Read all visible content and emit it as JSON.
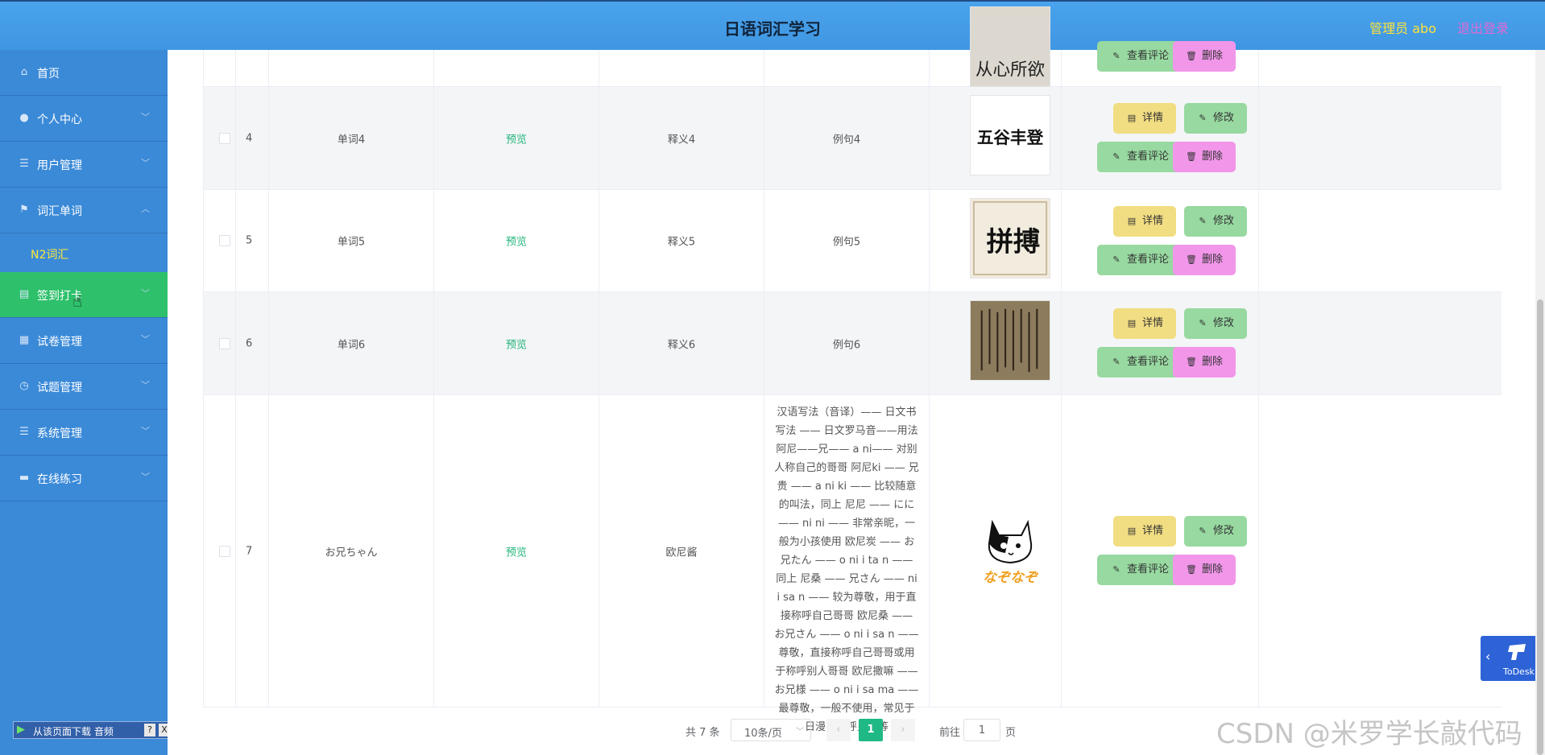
{
  "header": {
    "title": "日语词汇学习",
    "admin": "管理员 abo",
    "logout": "退出登录"
  },
  "sidebar": {
    "items": [
      {
        "label": "首页",
        "icon": "home-icon"
      },
      {
        "label": "个人中心",
        "icon": "user-icon"
      },
      {
        "label": "用户管理",
        "icon": "list-icon"
      },
      {
        "label": "词汇单词",
        "icon": "flag-icon"
      },
      {
        "label": "N2词汇",
        "sub": true
      },
      {
        "label": "签到打卡",
        "icon": "calendar-icon"
      },
      {
        "label": "试卷管理",
        "icon": "grid-icon"
      },
      {
        "label": "试题管理",
        "icon": "clock-icon"
      },
      {
        "label": "系统管理",
        "icon": "list-icon"
      },
      {
        "label": "在线练习",
        "icon": "monitor-icon"
      }
    ]
  },
  "table": {
    "rows": [
      {
        "idx": "4",
        "word": "单词4",
        "preview": "预览",
        "meaning": "释义4",
        "example": "例句4"
      },
      {
        "idx": "5",
        "word": "单词5",
        "preview": "预览",
        "meaning": "释义5",
        "example": "例句5"
      },
      {
        "idx": "6",
        "word": "单词6",
        "preview": "预览",
        "meaning": "释义6",
        "example": "例句6"
      },
      {
        "idx": "7",
        "word": "お兄ちゃん",
        "preview": "预览",
        "meaning": "欧尼酱",
        "example": "汉语写法（音译）—— 日文书写法 —— 日文罗马音——用法 阿尼——兄—— a ni—— 对别人称自己的哥哥 阿尼ki —— 兄贵 —— a ni ki —— 比较随意的叫法，同上 尼尼 —— にに —— ni ni —— 非常亲昵，一般为小孩使用 欧尼炭 —— お兄たん —— o ni i ta n —— 同上 尼桑 —— 兄さん —— ni i sa n —— 较为尊敬，用于直接称呼自己哥哥 欧尼桑 —— お兄さん —— o ni i sa n —— 尊敬，直接称呼自己哥哥或用于称呼别人哥哥 欧尼撒嘛 —— お兄様 —— o ni i sa ma —— 最尊敬，一般不使用，常见于日漫中称呼皇兄等"
      }
    ],
    "actions": {
      "detail": "详情",
      "edit": "修改",
      "comment": "查看评论",
      "delete": "删除"
    },
    "image_text": {
      "row4": "五谷丰登",
      "row5": "拼搏",
      "row7": "なぞなぞ",
      "top_partial": "从心所欲"
    }
  },
  "pagination": {
    "total": "共 7 条",
    "page_size": "10条/页",
    "current": "1",
    "goto_prefix": "前往",
    "goto_value": "1",
    "goto_suffix": "页"
  },
  "audio_toolbar": {
    "label": "从该页面下载 音频",
    "help": "?",
    "close": "X"
  },
  "todesk": {
    "label": "ToDesk"
  },
  "watermark": "CSDN @米罗学长敲代码",
  "colors": {
    "header": "#4aa3ec",
    "sidebar": "#3b8ad8",
    "active_menu": "#2ec06b",
    "accent_yellow": "#ffe93b",
    "pagination_active": "#1fb985"
  }
}
